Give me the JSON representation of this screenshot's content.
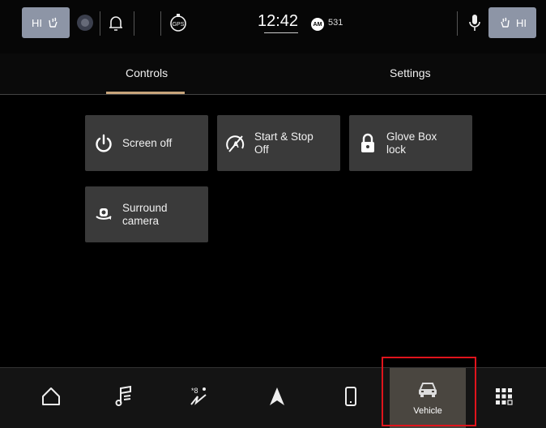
{
  "status": {
    "left_temp": "HI",
    "right_temp": "HI",
    "time": "12:42",
    "radio_band": "AM",
    "radio_freq": "531",
    "gps_label": "GPS"
  },
  "tabs": [
    {
      "label": "Controls",
      "active": true
    },
    {
      "label": "Settings",
      "active": false
    }
  ],
  "tiles": [
    {
      "label": "Screen off",
      "icon": "power-icon"
    },
    {
      "label": "Start & Stop\nOff",
      "icon": "start-stop-off-icon"
    },
    {
      "label": "Glove Box\nlock",
      "icon": "lock-icon"
    },
    {
      "label": "Surround\ncamera",
      "icon": "surround-camera-icon"
    }
  ],
  "bottom_nav": [
    {
      "name": "home",
      "icon": "home-icon"
    },
    {
      "name": "media",
      "icon": "music-icon"
    },
    {
      "name": "climate",
      "icon": "climate-icon"
    },
    {
      "name": "navigation",
      "icon": "navigation-icon"
    },
    {
      "name": "phone",
      "icon": "phone-icon"
    },
    {
      "name": "vehicle",
      "icon": "car-icon",
      "label": "Vehicle",
      "active": true
    },
    {
      "name": "apps",
      "icon": "apps-grid-icon"
    }
  ],
  "colors": {
    "tile_bg": "#3a3a3a",
    "tab_indicator": "#c7a47a",
    "highlight": "#e0141c",
    "status_pill": "#8d95a6"
  }
}
